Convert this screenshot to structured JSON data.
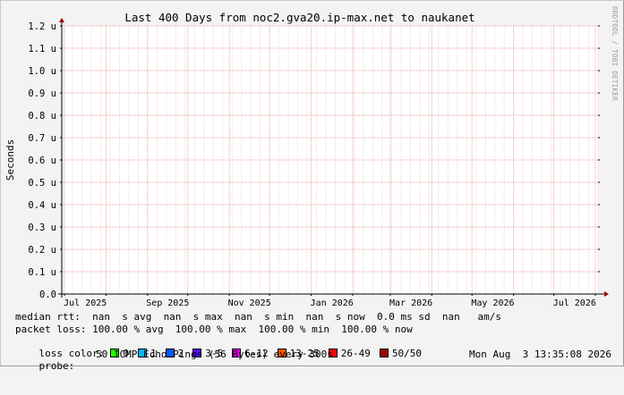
{
  "chart_data": {
    "type": "line",
    "title": "Last 400 Days from noc2.gva20.ip-max.net to naukanet",
    "ylabel": "Seconds",
    "xlabel": "",
    "ylim": [
      0,
      1.2
    ],
    "y_unit_suffix": "u",
    "y_ticks": [
      "0.0",
      "0.1 u",
      "0.2 u",
      "0.3 u",
      "0.4 u",
      "0.5 u",
      "0.6 u",
      "0.7 u",
      "0.8 u",
      "0.9 u",
      "1.0 u",
      "1.1 u",
      "1.2 u"
    ],
    "x_ticks": [
      "Jul 2025",
      "Sep 2025",
      "Nov 2025",
      "Jan 2026",
      "Mar 2026",
      "May 2026",
      "Jul 2026"
    ],
    "x_range": [
      "2025-06-29",
      "2026-08-03"
    ],
    "grid": true,
    "series": []
  },
  "watermark": "RRDTOOL / TOBI OETIKER",
  "stats": {
    "median_rtt": "median rtt:  nan  s avg  nan  s max  nan  s min  nan  s now  0.0 ms sd  nan   am/s",
    "packet_loss": "packet loss: 100.00 % avg  100.00 % max  100.00 % min  100.00 % now",
    "loss_color_label": "loss color:",
    "loss_colors": [
      {
        "label": "0",
        "color": "#26ff00"
      },
      {
        "label": "1",
        "color": "#00b8ff"
      },
      {
        "label": "2",
        "color": "#0059ff"
      },
      {
        "label": "3-5",
        "color": "#5e00ff"
      },
      {
        "label": "6-12",
        "color": "#ff00ff"
      },
      {
        "label": "13-25",
        "color": "#ff5500"
      },
      {
        "label": "26-49",
        "color": "#ff0000"
      },
      {
        "label": "50/50",
        "color": "#a10000"
      }
    ],
    "probe_label": "probe:",
    "probe_text": "50 ICMP Echo Pings (56 Bytes) every 300s",
    "timestamp": "Mon Aug  3 13:35:08 2026"
  }
}
